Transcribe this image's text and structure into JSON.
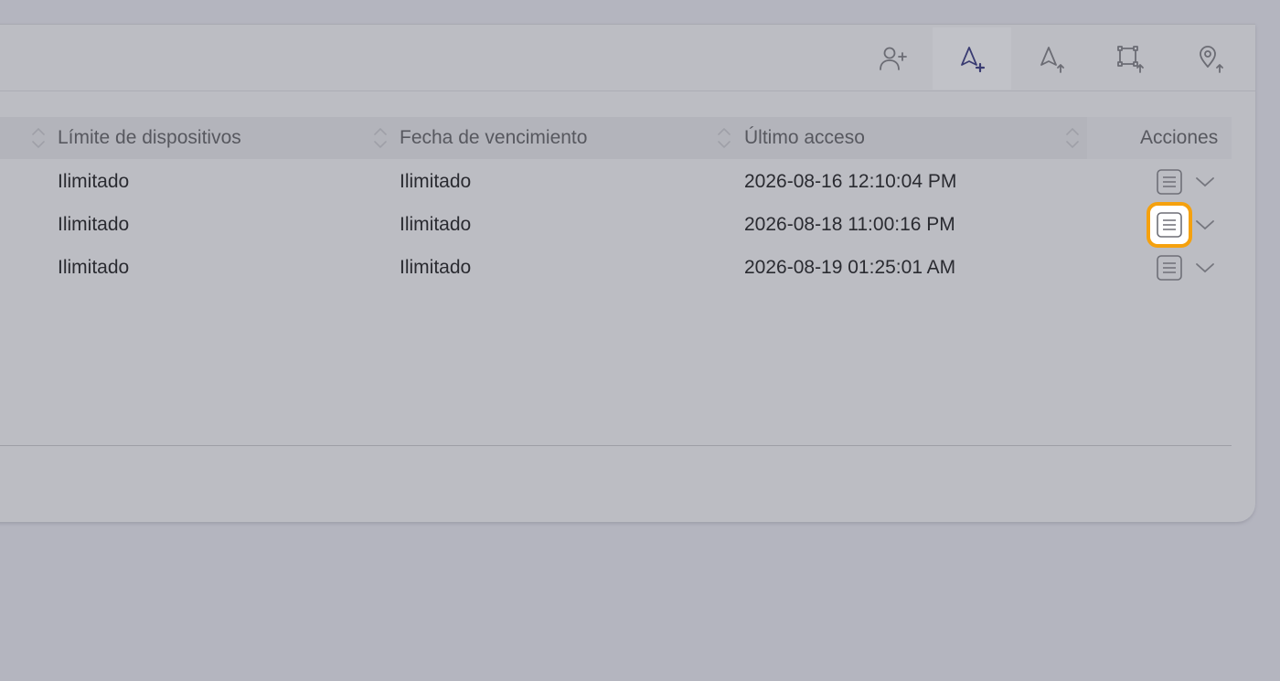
{
  "toolbar": {
    "buttons": [
      {
        "icon": "add-user-icon"
      },
      {
        "icon": "add-vehicle-icon",
        "active": true
      },
      {
        "icon": "upload-vehicle-icon"
      },
      {
        "icon": "upload-geofence-icon"
      },
      {
        "icon": "upload-poi-icon"
      }
    ]
  },
  "table": {
    "columns": {
      "device_limit": "Límite de dispositivos",
      "expiry_date": "Fecha de vencimiento",
      "last_access": "Último acceso",
      "actions": "Acciones"
    },
    "rows": [
      {
        "device_limit": "Ilimitado",
        "expiry_date": "Ilimitado",
        "last_access": "2026-08-16 12:10:04 PM"
      },
      {
        "device_limit": "Ilimitado",
        "expiry_date": "Ilimitado",
        "last_access": "2026-08-18 11:00:16 PM"
      },
      {
        "device_limit": "Ilimitado",
        "expiry_date": "Ilimitado",
        "last_access": "2026-08-19 01:25:01 AM"
      }
    ]
  },
  "colors": {
    "highlight": "#f5a10e",
    "active_icon": "#3a3c72"
  }
}
